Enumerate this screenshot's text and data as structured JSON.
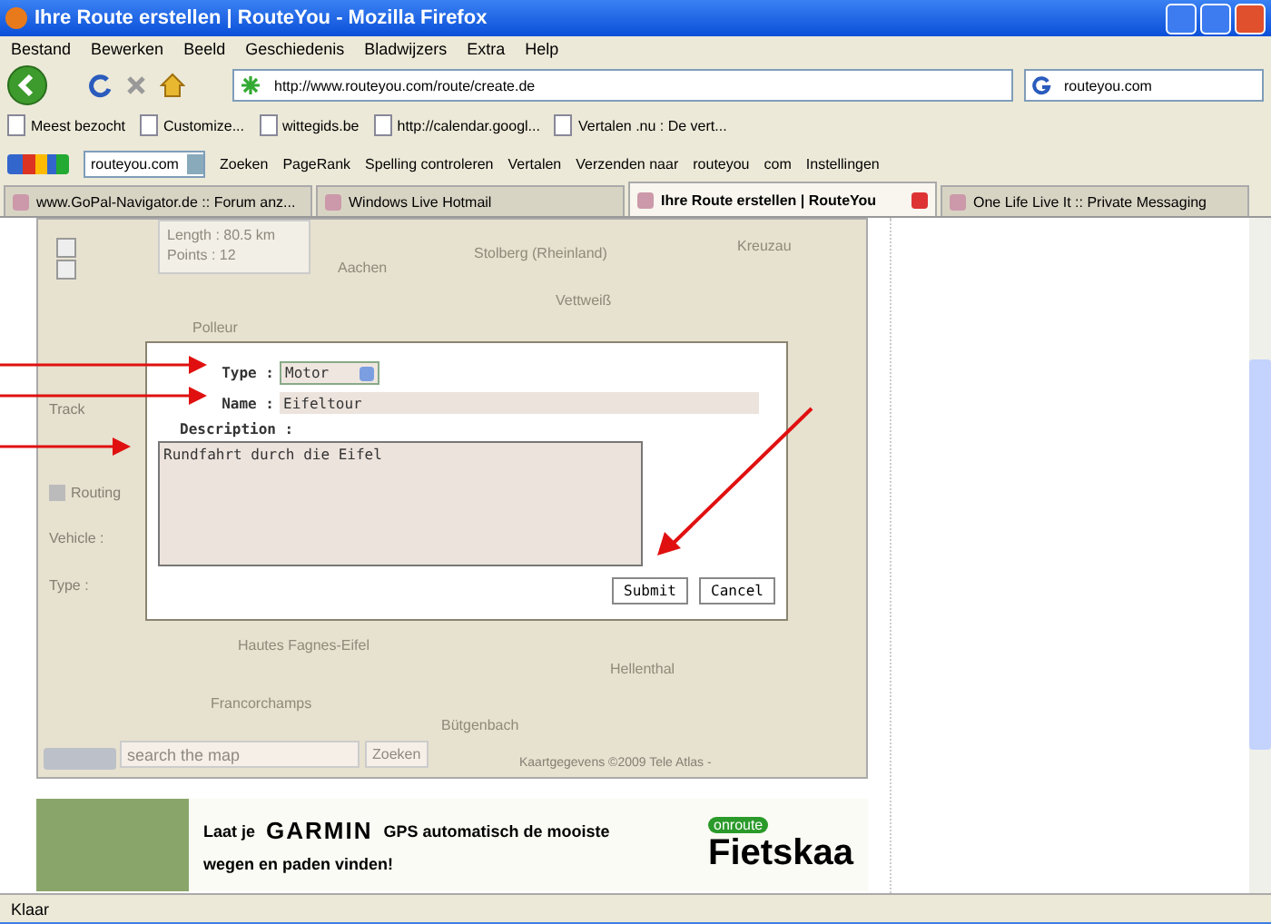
{
  "window": {
    "title": "Ihre Route erstellen | RouteYou - Mozilla Firefox"
  },
  "menu": [
    "Bestand",
    "Bewerken",
    "Beeld",
    "Geschiedenis",
    "Bladwijzers",
    "Extra",
    "Help"
  ],
  "navigation": {
    "url": "http://www.routeyou.com/route/create.de",
    "search_value": "routeyou.com"
  },
  "bookmarks": [
    "Meest bezocht",
    "Customize...",
    "wittegids.be",
    "http://calendar.googl...",
    "Vertalen .nu : De vert..."
  ],
  "google_toolbar": {
    "search_value": "routeyou.com",
    "items": [
      "Zoeken",
      "PageRank",
      "Spelling controleren",
      "Vertalen",
      "Verzenden naar",
      "routeyou",
      "com",
      "Instellingen"
    ]
  },
  "tabs": [
    {
      "label": "www.GoPal-Navigator.de :: Forum anz...",
      "selected": false
    },
    {
      "label": "Windows Live Hotmail",
      "selected": false
    },
    {
      "label": "Ihre Route erstellen | RouteYou",
      "selected": true
    },
    {
      "label": "One Life Live It :: Private Messaging",
      "selected": false
    }
  ],
  "map": {
    "info": [
      "Length : 80.5 km",
      "Points : 12"
    ],
    "labels": [
      "Aachen",
      "Stolberg (Rheinland)",
      "Polleur",
      "Kreuzau",
      "Vettweiß",
      "Hautes Fagnes-Eifel",
      "Hellenthal",
      "Francorchamps",
      "Bütgenbach"
    ],
    "search_placeholder": "search the map",
    "search_button": "Zoeken",
    "copyright": "Kaartgegevens ©2009 Tele Atlas -"
  },
  "side_panel": {
    "track_label": "Track",
    "routing": {
      "label": "Routing",
      "checked": true
    },
    "vehicle_label": "Vehicle :",
    "type_label": "Type :"
  },
  "dialog": {
    "type_label": "Type :",
    "type_value": "Motor",
    "name_label": "Name :",
    "name_value": "Eifeltour",
    "description_label": "Description :",
    "description_value": "Rundfahrt durch die Eifel",
    "buttons": [
      "Submit",
      "Cancel"
    ]
  },
  "ad": {
    "lead": "Laat je",
    "brand": "GARMIN",
    "line_1": "GPS automatisch de mooiste",
    "line_2": "wegen en paden vinden!",
    "logo": "onroute",
    "product": "Fietskaa"
  },
  "status_bar": {
    "text": "Klaar"
  }
}
